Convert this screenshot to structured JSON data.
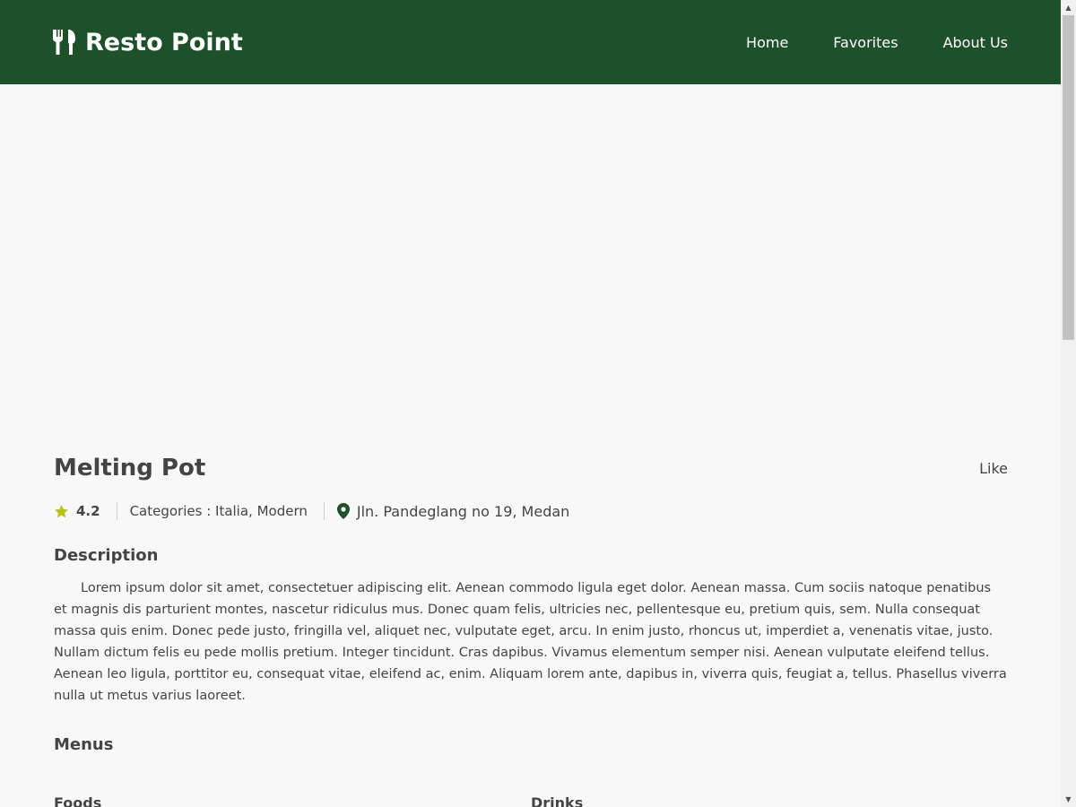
{
  "header": {
    "brand": "Resto Point",
    "nav": [
      "Home",
      "Favorites",
      "About Us"
    ]
  },
  "restaurant": {
    "name": "Melting Pot",
    "like_label": "Like",
    "rating": "4.2",
    "categories": "Categories : Italia, Modern",
    "address": "Jln. Pandeglang no 19, Medan"
  },
  "description": {
    "title": "Description",
    "text": "Lorem ipsum dolor sit amet, consectetuer adipiscing elit. Aenean commodo ligula eget dolor. Aenean massa. Cum sociis natoque penatibus et magnis dis parturient montes, nascetur ridiculus mus. Donec quam felis, ultricies nec, pellentesque eu, pretium quis, sem. Nulla consequat massa quis enim. Donec pede justo, fringilla vel, aliquet nec, vulputate eget, arcu. In enim justo, rhoncus ut, imperdiet a, venenatis vitae, justo. Nullam dictum felis eu pede mollis pretium. Integer tincidunt. Cras dapibus. Vivamus elementum semper nisi. Aenean vulputate eleifend tellus. Aenean leo ligula, porttitor eu, consequat vitae, eleifend ac, enim. Aliquam lorem ante, dapibus in, viverra quis, feugiat a, tellus. Phasellus viverra nulla ut metus varius laoreet."
  },
  "menus": {
    "title": "Menus",
    "foods_title": "Foods",
    "drinks_title": "Drinks"
  },
  "colors": {
    "header_bg": "#1e512a",
    "star": "#b5c21a",
    "pin": "#1e512a",
    "page_bg": "#f8f8f8"
  },
  "icons": {
    "brand": "utensils-icon",
    "rating": "star-icon",
    "address": "map-pin-icon"
  }
}
